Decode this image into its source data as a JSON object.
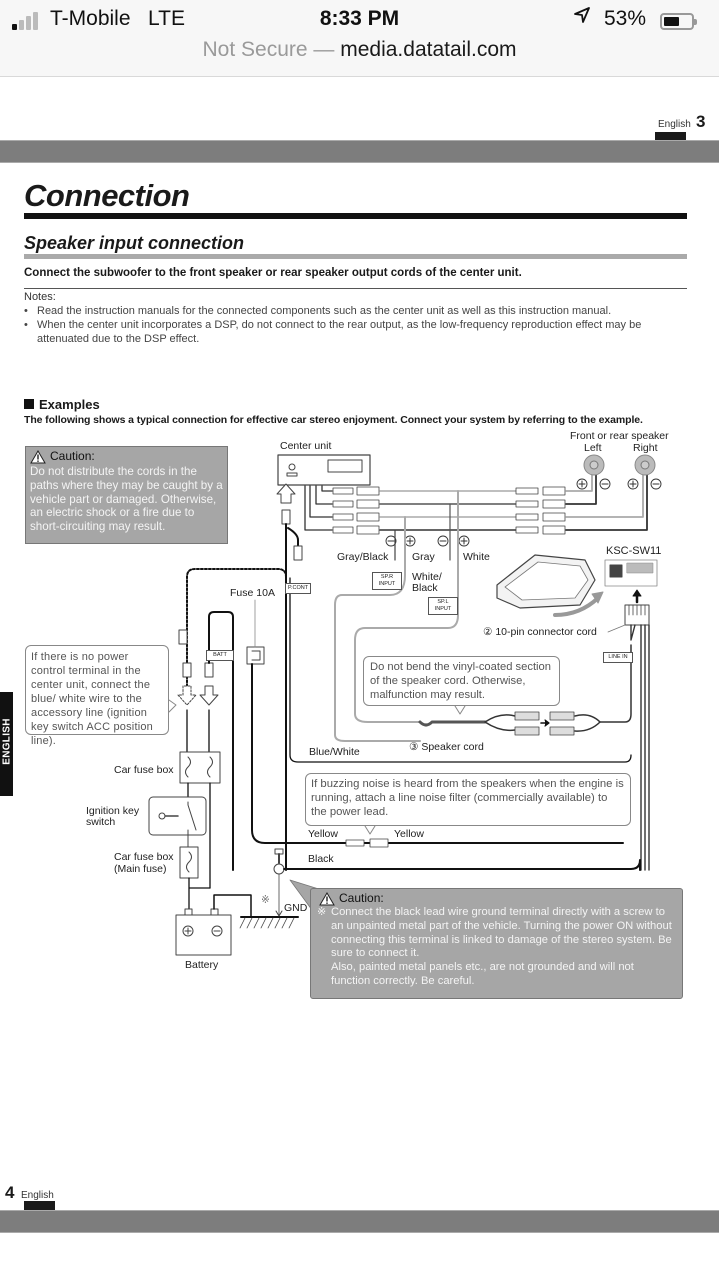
{
  "status_bar": {
    "carrier": "T-Mobile",
    "network": "LTE",
    "time": "8:33 PM",
    "battery_percent": "53%",
    "battery_level": 0.53,
    "signal_bars_active": 1,
    "signal_bars_total": 4
  },
  "browser": {
    "security_label": "Not Secure —",
    "host": "media.datatail.com"
  },
  "page_top": {
    "lang": "English",
    "number": "3"
  },
  "document": {
    "title": "Connection",
    "section": "Speaker input connection",
    "lead": "Connect the subwoofer to the front speaker or rear speaker output cords of the center unit.",
    "notes_heading": "Notes:",
    "notes": [
      "Read the instruction manuals for the connected components such as the center unit as well as this instruction manual.",
      "When the center unit incorporates a DSP, do not connect to the rear output, as the low-frequency reproduction effect may be attenuated due to the DSP effect."
    ],
    "bullet": "•",
    "examples_heading": "Examples",
    "examples_sub": "The following shows a typical connection for effective car stereo enjoyment. Connect your system by referring to the example."
  },
  "caution_top": {
    "heading": "Caution:",
    "text": "Do not distribute the cords in the paths where they may be caught by a vehicle part or damaged. Otherwise, an electric shock or a fire due to short-circuiting may result."
  },
  "caution_bottom": {
    "heading": "Caution:",
    "mark": "※",
    "lines": [
      "Connect the black lead wire ground terminal directly with a screw to an unpainted metal part of the vehicle. Turning the power ON without connecting this terminal is linked to damage of the stereo system. Be sure to connect it.",
      "Also, painted metal panels etc., are not grounded and will not function correctly. Be careful."
    ]
  },
  "bubbles": {
    "accessory": "If there is no power control terminal in the center unit, connect the blue/ white wire to the accessory line (ignition key switch ACC position line).",
    "vinyl": "Do not bend the vinyl-coated section of the speaker cord. Otherwise, malfunction may result.",
    "noise": "If buzzing noise is heard from the speakers when the engine is running, attach a line noise filter (commercially available) to the power lead."
  },
  "diagram_labels": {
    "center_unit": "Center unit",
    "speakers_heading": "Front or rear speaker",
    "left": "Left",
    "right": "Right",
    "gray_black": "Gray/Black",
    "gray": "Gray",
    "white": "White",
    "white_black": "White/ Black",
    "model": "KSC-SW11",
    "fuse": "Fuse 10A",
    "connector_cord": "② 10-pin connector cord",
    "speaker_cord": "③ Speaker cord",
    "blue_white": "Blue/White",
    "yellow_left": "Yellow",
    "yellow_right": "Yellow",
    "black": "Black",
    "car_fuse_box": "Car fuse box",
    "ignition_switch": "Ignition key switch",
    "main_fuse_box": "Car fuse box (Main fuse)",
    "battery": "Battery",
    "gnd": "GND",
    "gnd_mark": "※",
    "plus": "+",
    "minus": "−"
  },
  "tags": {
    "sp_r": "SP.R INPUT",
    "sp_l": "SP.L INPUT",
    "p_cont": "P.CONT",
    "batt": "BATT",
    "line_in": "LINE IN"
  },
  "side_tab": "ENGLISH",
  "page_bottom": {
    "lang": "English",
    "number": "4"
  }
}
